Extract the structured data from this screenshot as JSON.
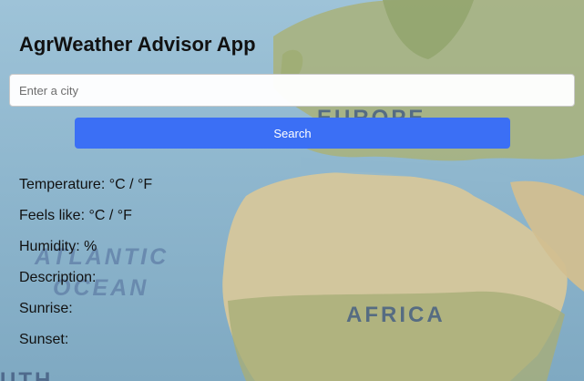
{
  "app": {
    "title": "AgrWeather Advisor App"
  },
  "search": {
    "placeholder": "Enter a city",
    "value": "",
    "button_label": "Search"
  },
  "weather": {
    "temperature": "Temperature: °C / °F",
    "feels_like": "Feels like: °C / °F",
    "humidity": "Humidity: %",
    "description": "Description:",
    "sunrise": "Sunrise:",
    "sunset": "Sunset:"
  },
  "background_map": {
    "labels": {
      "europe": "EUROPE",
      "atlantic": "ATLANTIC",
      "ocean": "OCEAN",
      "africa": "AFRICA",
      "partial_bottom_left": "UTH"
    }
  },
  "colors": {
    "button": "#3b6ff5",
    "ocean": "#8fb7ce",
    "land": "#c9c08f",
    "desert": "#d8c9a0"
  }
}
